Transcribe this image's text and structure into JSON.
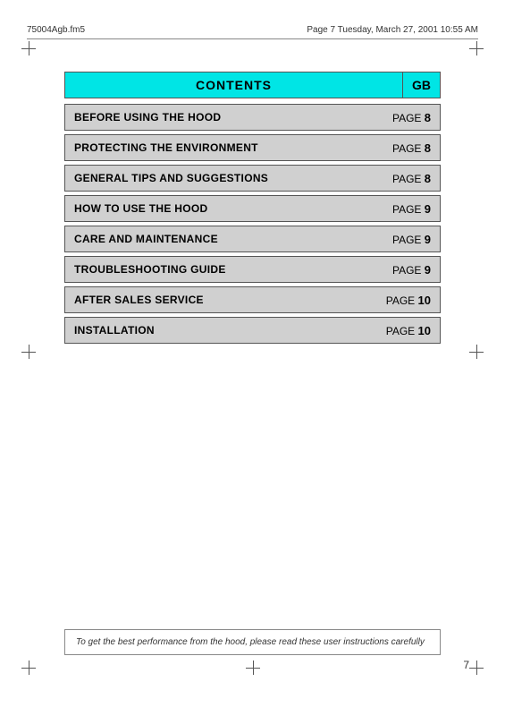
{
  "header": {
    "filename": "75004Agb.fm5",
    "page_info": "Page 7  Tuesday, March 27, 2001  10:55 AM"
  },
  "contents": {
    "title": "CONTENTS",
    "gb_label": "GB",
    "rows": [
      {
        "label": "BEFORE USING THE HOOD",
        "page_text": "PAGE",
        "page_num": "8"
      },
      {
        "label": "PROTECTING THE ENVIRONMENT",
        "page_text": "PAGE",
        "page_num": "8"
      },
      {
        "label": "GENERAL TIPS AND SUGGESTIONS",
        "page_text": "PAGE",
        "page_num": "8"
      },
      {
        "label": "HOW TO USE THE HOOD",
        "page_text": "PAGE",
        "page_num": "9"
      },
      {
        "label": "CARE AND MAINTENANCE",
        "page_text": "PAGE",
        "page_num": "9"
      },
      {
        "label": "TROUBLESHOOTING GUIDE",
        "page_text": "PAGE",
        "page_num": "9"
      },
      {
        "label": "AFTER SALES SERVICE",
        "page_text": "PAGE",
        "page_num": "10"
      },
      {
        "label": "INSTALLATION",
        "page_text": "PAGE",
        "page_num": "10"
      }
    ]
  },
  "footer": {
    "note": "To get the best performance from the hood, please read these user instructions carefully"
  },
  "page_number": "7"
}
